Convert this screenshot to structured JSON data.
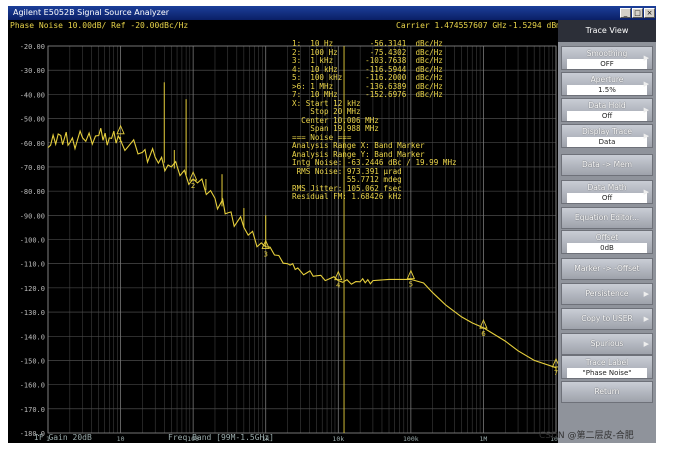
{
  "window": {
    "title": "Agilent E5052B Signal Source Analyzer",
    "minimize_glyph": "_",
    "maximize_glyph": "□",
    "close_glyph": "×"
  },
  "plot_header": {
    "trace_label": "Phase Noise 10.00dB/ Ref -20.00dBc/Hz",
    "carrier": "Carrier 1.474557607 GHz",
    "carrier_power": "-1.5294 dBm",
    "status_bottom_left": "IF Gain 20dB",
    "status_bottom_center": "Freq Band [99M-1.5GHz]"
  },
  "marker_info": [
    "1:  10 Hz        -56.3141  dBc/Hz",
    "2:  100 Hz       -75.4302  dBc/Hz",
    "3:  1 kHz       -103.7638  dBc/Hz",
    "4:  10 kHz      -116.5944  dBc/Hz",
    "5:  100 kHz     -116.2000  dBc/Hz",
    ">6: 1 MHz       -136.6389  dBc/Hz",
    "7:  10 MHz      -152.6976  dBc/Hz",
    "X: Start 12 kHz",
    "    Stop 20 MHz",
    "  Center 10.006 MHz",
    "    Span 19.988 MHz",
    "=== Noise ===",
    "Analysis Range X: Band Marker",
    "Analysis Range Y: Band Marker",
    "Intg Noise: -63.2446 dBc / 19.99 MHz",
    " RMS Noise: 973.391 µrad",
    "            55.7712 mdeg",
    "RMS Jitter: 105.062 fsec",
    "Residual FM: 1.68426 kHz"
  ],
  "side_panel": {
    "title": "Trace View",
    "keys": [
      {
        "label": "Smoothing",
        "value": "OFF"
      },
      {
        "label": "Aperture",
        "value": "1.5%"
      },
      {
        "label": "Data Hold",
        "value": "Off"
      },
      {
        "label": "Display Trace",
        "value": "Data"
      },
      {
        "label": "Data -> Mem",
        "value": ""
      },
      {
        "label": "Data Math",
        "value": "Off"
      },
      {
        "label": "Equation Editor...",
        "value": ""
      },
      {
        "label": "Offset",
        "value": "0dB"
      },
      {
        "label": "Marker -> -Offset",
        "value": ""
      },
      {
        "label": "Persistence",
        "value": ""
      },
      {
        "label": "Copy to USER",
        "value": ""
      },
      {
        "label": "Spurious",
        "value": ""
      },
      {
        "label": "Trace Label",
        "value": "\"Phase Noise\""
      },
      {
        "label": "Return",
        "value": ""
      }
    ]
  },
  "watermark": "CSDN @第二层皮-合肥",
  "chart_data": {
    "type": "line",
    "x_scale": "log",
    "xlim": [
      1,
      10000000
    ],
    "ylim": [
      -180,
      -20
    ],
    "y_ticks": [
      -20,
      -30,
      -40,
      -50,
      -60,
      -70,
      -80,
      -90,
      -100,
      -110,
      -120,
      -130,
      -140,
      -150,
      -160,
      -170,
      -180
    ],
    "y_tick_labels": [
      "-20.00",
      "-30.00",
      "-40.00",
      "-50.00",
      "-60.00",
      "-70.00",
      "-80.00",
      "-90.00",
      "-100.0",
      "-110.0",
      "-120.0",
      "-130.0",
      "-140.0",
      "-150.0",
      "-160.0",
      "-170.0",
      "-180.0"
    ],
    "x_tick_labels": [
      "1",
      "10",
      "100",
      "1k",
      "10k",
      "100k",
      "1M",
      "10M"
    ],
    "grid": true,
    "series": [
      {
        "color": "#e6cf3c",
        "x": [
          1,
          1.5,
          2,
          3,
          5,
          7,
          10,
          20,
          30,
          50,
          100,
          200,
          300,
          500,
          1000,
          2000,
          3000,
          5000,
          10000,
          20000,
          30000,
          50000,
          100000,
          150000,
          200000,
          300000,
          500000,
          700000,
          1000000,
          2000000,
          3000000,
          5000000,
          10000000,
          20000000
        ],
        "y": [
          -62,
          -57,
          -60,
          -58,
          -57,
          -58,
          -59,
          -64,
          -66,
          -70,
          -75,
          -83,
          -89,
          -95,
          -103,
          -110,
          -113,
          -115,
          -117,
          -117.5,
          -117,
          -116.5,
          -116.5,
          -118,
          -122,
          -127,
          -132,
          -134.5,
          -136.5,
          -142,
          -146,
          -150,
          -153,
          -154
        ]
      }
    ],
    "spurs": [
      {
        "x": 40,
        "y": -35
      },
      {
        "x": 55,
        "y": -63
      },
      {
        "x": 80,
        "y": -42
      },
      {
        "x": 150,
        "y": -75
      },
      {
        "x": 250,
        "y": -73
      },
      {
        "x": 500,
        "y": -87
      },
      {
        "x": 1000,
        "y": -90
      }
    ],
    "markers": [
      {
        "label": "1",
        "x": 10,
        "y": -56.3141
      },
      {
        "label": "2",
        "x": 100,
        "y": -75.4302
      },
      {
        "label": "3",
        "x": 1000,
        "y": -103.7638
      },
      {
        "label": "4",
        "x": 10000,
        "y": -116.5944
      },
      {
        "label": "5",
        "x": 100000,
        "y": -116.2
      },
      {
        "label": "6",
        "x": 1000000,
        "y": -136.6389
      },
      {
        "label": "7",
        "x": 10000000,
        "y": -152.6976
      }
    ],
    "band_start": 12000
  }
}
